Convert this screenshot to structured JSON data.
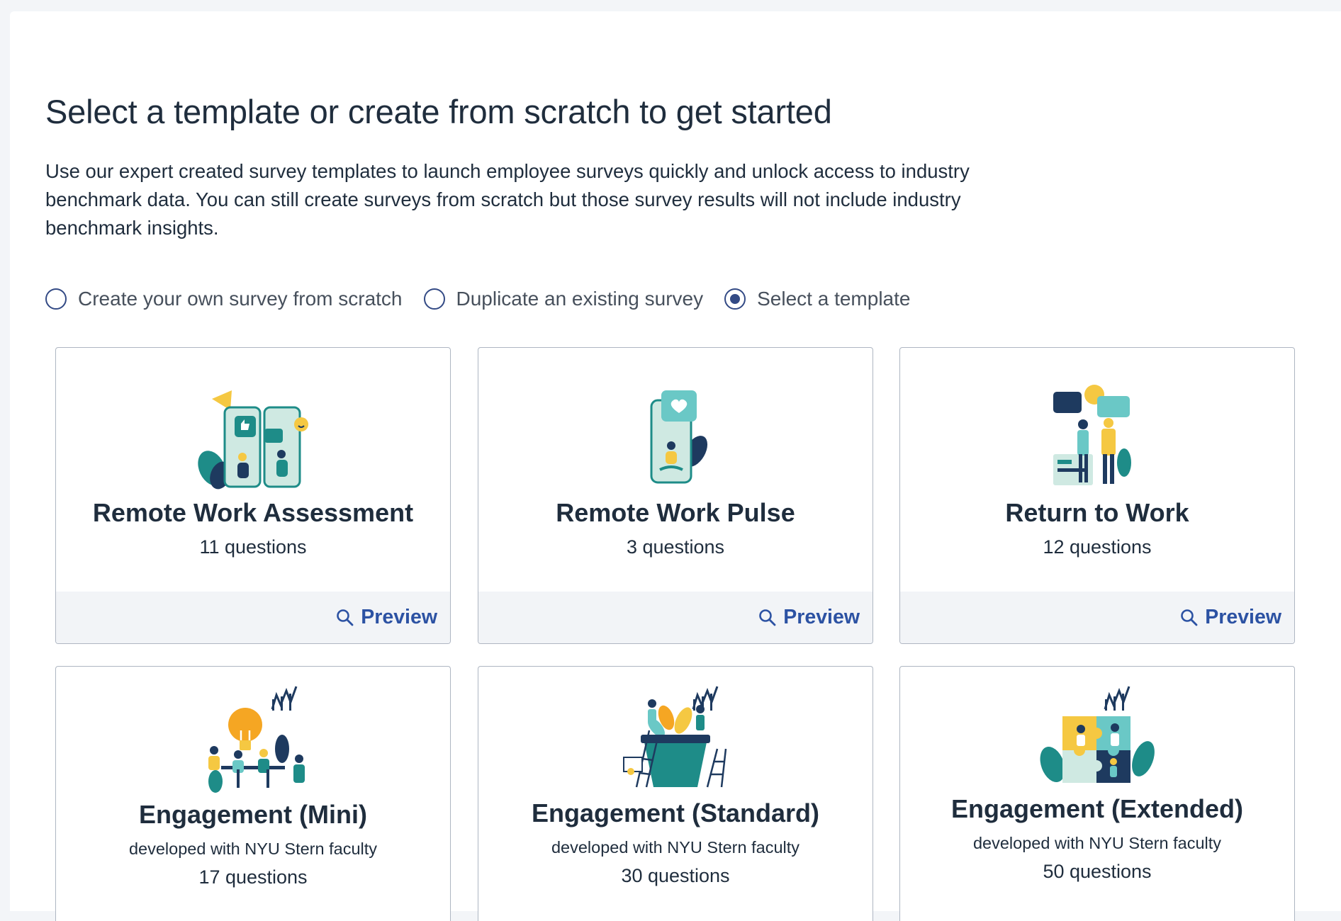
{
  "header": {
    "title": "Select a template or create from scratch to get started",
    "description": "Use our expert created survey templates to launch employee surveys quickly and unlock access to industry benchmark data. You can still create surveys from scratch but those survey results will not include industry benchmark insights."
  },
  "options": [
    {
      "label": "Create your own survey from scratch",
      "selected": false
    },
    {
      "label": "Duplicate an existing survey",
      "selected": false
    },
    {
      "label": "Select a template",
      "selected": true
    }
  ],
  "preview_label": "Preview",
  "templates": [
    {
      "name": "Remote Work Assessment",
      "count": "11 questions",
      "icon": "remote-work-illustration"
    },
    {
      "name": "Remote Work Pulse",
      "count": "3 questions",
      "icon": "phone-heart-illustration"
    },
    {
      "name": "Return to Work",
      "count": "12 questions",
      "icon": "office-handshake-illustration"
    },
    {
      "name": "Engagement (Mini)",
      "subtitle": "developed with NYU Stern faculty",
      "count": "17 questions",
      "icon": "lightbulb-team-illustration"
    },
    {
      "name": "Engagement (Standard)",
      "subtitle": "developed with NYU Stern faculty",
      "count": "30 questions",
      "icon": "growth-pot-illustration"
    },
    {
      "name": "Engagement (Extended)",
      "subtitle": "developed with NYU Stern faculty",
      "count": "50 questions",
      "icon": "puzzle-team-illustration"
    }
  ],
  "colors": {
    "accent": "#2c52a3",
    "radio": "#334a85",
    "teal": "#1e8c88",
    "yellow": "#f5c842",
    "navy": "#1e3a5f"
  }
}
